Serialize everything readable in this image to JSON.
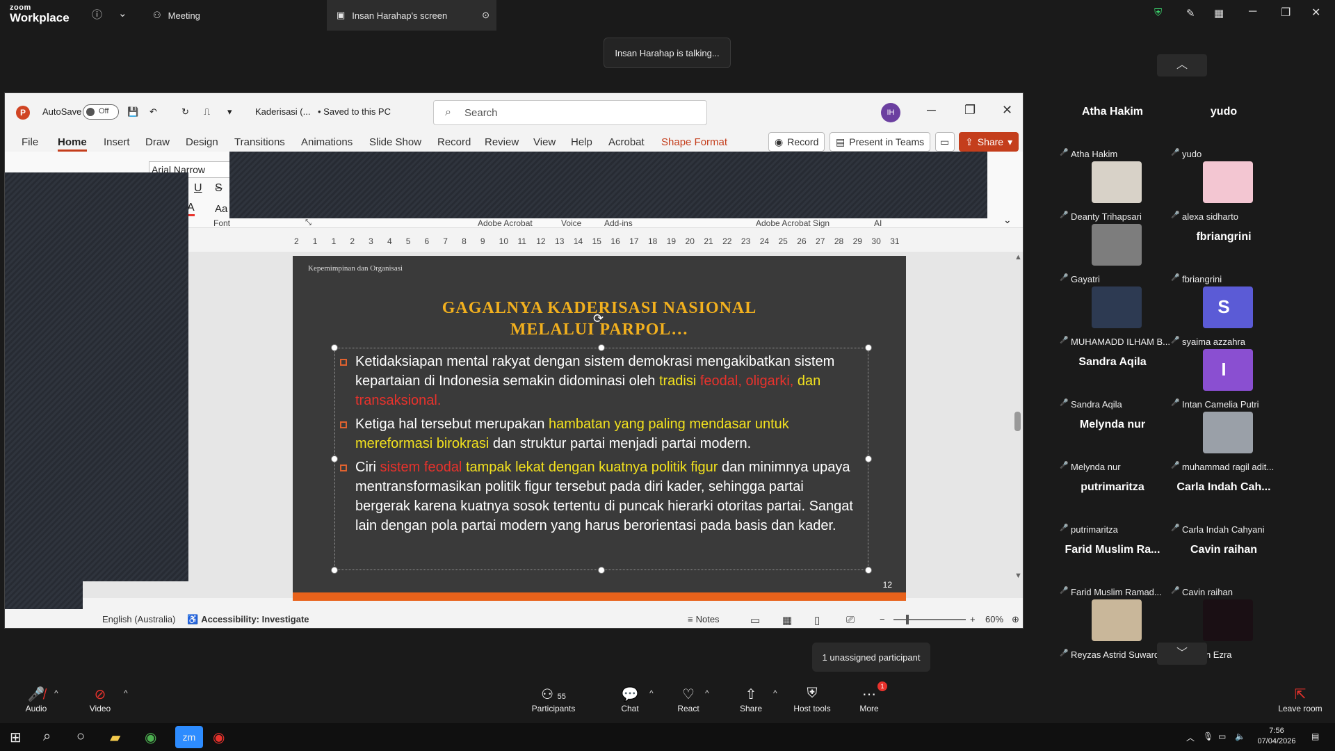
{
  "zoom": {
    "logo_l1": "zoom",
    "logo_l2": "Workplace",
    "tab_meeting": "Meeting",
    "tab_screen": "Insan Harahap's screen",
    "talking": "Insan Harahap is talking...",
    "unassigned": "1 unassigned participant",
    "toolbar": {
      "audio": "Audio",
      "video": "Video",
      "participants": "Participants",
      "participants_count": "55",
      "chat": "Chat",
      "react": "React",
      "share": "Share",
      "host_tools": "Host tools",
      "more": "More",
      "more_badge": "1",
      "leave": "Leave room"
    }
  },
  "ppt": {
    "autosave": "AutoSave",
    "toggle": "Off",
    "filename": "Kaderisasi (...",
    "saved": "• Saved to this PC",
    "search_placeholder": "Search",
    "avatar": "IH",
    "tabs": [
      "File",
      "Home",
      "Insert",
      "Draw",
      "Design",
      "Transitions",
      "Animations",
      "Slide Show",
      "Record",
      "Review",
      "View",
      "Help",
      "Acrobat",
      "Shape Format"
    ],
    "record_btn": "Record",
    "present_btn": "Present in Teams",
    "share_btn": "Share",
    "font_name": "Arial Narrow",
    "groups": [
      "Font",
      "Adobe Acrobat",
      "Voice",
      "Add-ins",
      "Adobe Acrobat Sign",
      "AI"
    ],
    "ruler": [
      "2",
      "1",
      "1",
      "2",
      "3",
      "4",
      "5",
      "6",
      "7",
      "8",
      "9",
      "10",
      "11",
      "12",
      "13",
      "14",
      "15",
      "16",
      "17",
      "18",
      "19",
      "20",
      "21",
      "22",
      "23",
      "24",
      "25",
      "26",
      "27",
      "28",
      "29",
      "30",
      "31"
    ],
    "status": {
      "language": "English (Australia)",
      "accessibility": "Accessibility: Investigate",
      "notes": "Notes",
      "zoom": "60%"
    }
  },
  "slide": {
    "header": "Kepemimpinan dan Organisasi",
    "title_l1": "GAGALNYA KADERISASI NASIONAL",
    "title_l2": "MELALUI PARPOL…",
    "b1": {
      "t1": "Ketidaksiapan mental rakyat dengan sistem demokrasi mengakibatkan sistem kepartaian di Indonesia semakin didominasi oleh ",
      "t2": "tradisi ",
      "t3": "feodal, oligarki, ",
      "t4": "dan",
      "t5": " transaksional."
    },
    "b2": {
      "t1": "Ketiga hal tersebut merupakan ",
      "t2": "hambatan yang paling mendasar untuk mereformasi birokrasi",
      "t3": " dan struktur partai menjadi partai modern."
    },
    "b3": {
      "t1": "Ciri ",
      "t2": "sistem feodal ",
      "t3": "tampak lekat dengan kuatnya politik figur",
      "t4": " dan minimnya upaya mentransformasikan politik figur tersebut pada diri kader, sehingga partai bergerak karena kuatnya sosok tertentu di puncak hierarki otoritas partai. Sangat lain dengan pola partai modern yang harus berorientasi pada basis dan kader."
    },
    "page": "12"
  },
  "gallery": [
    {
      "big": "Atha Hakim",
      "label": "Atha Hakim",
      "photo": ""
    },
    {
      "big": "yudo",
      "label": "yudo",
      "photo": ""
    },
    {
      "big": "",
      "label": "Deanty Trihapsari",
      "photo": "#d8d2c8"
    },
    {
      "big": "",
      "label": "alexa sidharto",
      "photo": "#f3c6d2"
    },
    {
      "big": "",
      "label": "Gayatri",
      "photo": "#7d7d7d"
    },
    {
      "big": "fbriangrini",
      "label": "fbriangrini",
      "photo": ""
    },
    {
      "big": "",
      "label": "MUHAMADD ILHAM B...",
      "photo": "#2d3a52"
    },
    {
      "big": "S",
      "label": "syaima azzahra",
      "photo": "#5b5bd6"
    },
    {
      "big": "Sandra Aqila",
      "label": "Sandra Aqila",
      "photo": ""
    },
    {
      "big": "I",
      "label": "Intan Camelia Putri",
      "photo": "#8a4fd1"
    },
    {
      "big": "Melynda nur",
      "label": "Melynda nur",
      "photo": ""
    },
    {
      "big": "",
      "label": "muhammad ragil adit...",
      "photo": "#9aa0a8"
    },
    {
      "big": "putrimaritza",
      "label": "putrimaritza",
      "photo": ""
    },
    {
      "big": "Carla Indah Cah...",
      "label": "Carla Indah Cahyani",
      "photo": ""
    },
    {
      "big": "Farid Muslim Ra...",
      "label": "Farid Muslim Ramad...",
      "photo": ""
    },
    {
      "big": "Cavin raihan",
      "label": "Cavin raihan",
      "photo": ""
    },
    {
      "big": "",
      "label": "Reyzas Astrid Suward...",
      "photo": "#c9b79a"
    },
    {
      "big": "",
      "label": "Zildjian Ezra",
      "photo": "#1a0f14"
    }
  ],
  "taskbar": {
    "time": "7:56",
    "date": "07/04/2026"
  }
}
